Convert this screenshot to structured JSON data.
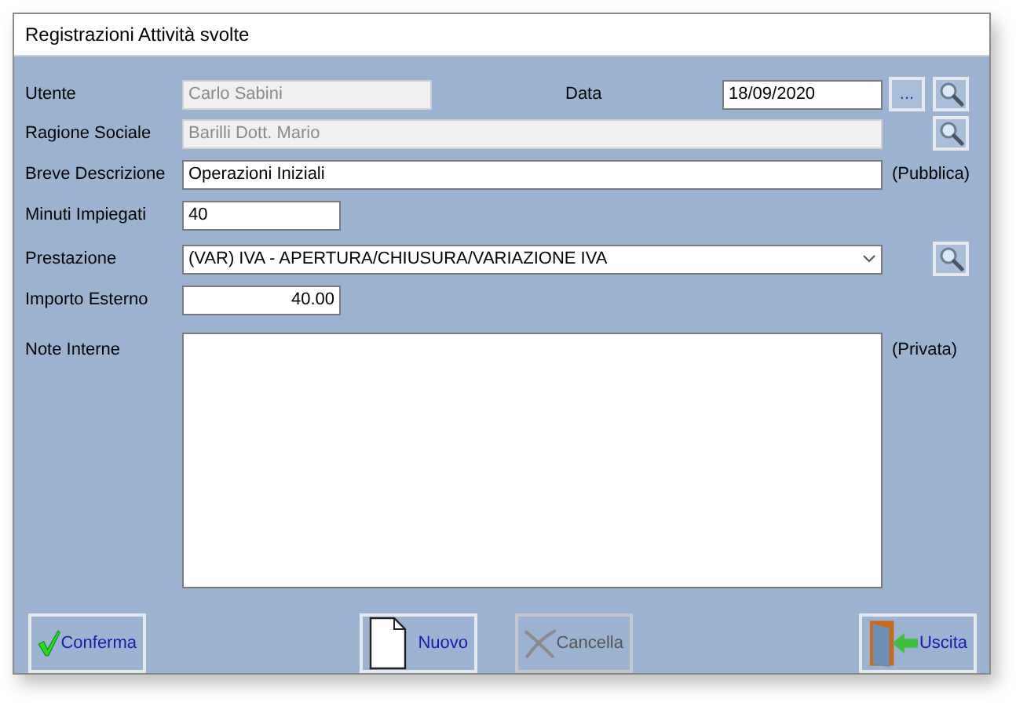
{
  "window": {
    "title": "Registrazioni Attività svolte"
  },
  "fields": {
    "utente": {
      "label": "Utente",
      "value": "Carlo Sabini",
      "disabled": true
    },
    "data": {
      "label": "Data",
      "value": "18/09/2020",
      "picker": "..."
    },
    "ragione_sociale": {
      "label": "Ragione Sociale",
      "value": "Barilli Dott. Mario",
      "disabled": true
    },
    "breve_descrizione": {
      "label": "Breve Descrizione",
      "value": "Operazioni Iniziali",
      "note": "(Pubblica)"
    },
    "minuti_impiegati": {
      "label": "Minuti Impiegati",
      "value": "40"
    },
    "prestazione": {
      "label": "Prestazione",
      "value": "(VAR) IVA - APERTURA/CHIUSURA/VARIAZIONE IVA"
    },
    "importo_esterno": {
      "label": "Importo Esterno",
      "value": "40.00"
    },
    "note_interne": {
      "label": "Note Interne",
      "note": "(Privata)"
    }
  },
  "buttons": [
    {
      "label": "Conferma",
      "kind": "check",
      "disabled": false
    },
    {
      "label": "Nuovo",
      "kind": "page",
      "disabled": false
    },
    {
      "label": "Cancella",
      "kind": "cross",
      "disabled": true
    },
    {
      "label": "Uscita",
      "kind": "door",
      "disabled": false
    }
  ]
}
